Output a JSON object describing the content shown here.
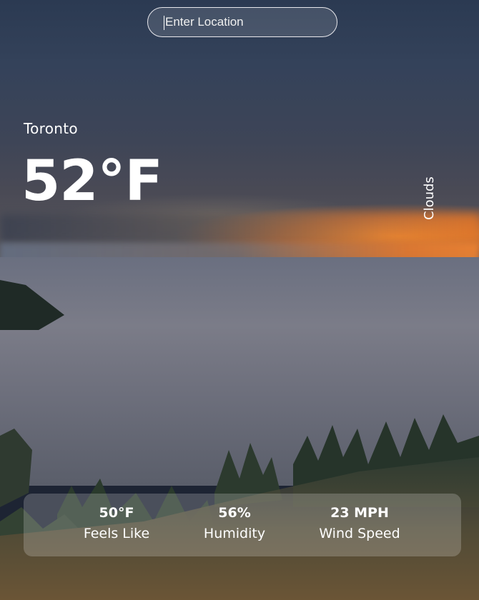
{
  "search": {
    "placeholder": "Enter Location",
    "value": ""
  },
  "weather": {
    "city": "Toronto",
    "temperature": "52°F",
    "condition": "Clouds"
  },
  "stats": {
    "feels_like": {
      "value": "50°F",
      "label": "Feels Like"
    },
    "humidity": {
      "value": "56%",
      "label": "Humidity"
    },
    "wind_speed": {
      "value": "23 MPH",
      "label": "Wind Speed"
    }
  }
}
